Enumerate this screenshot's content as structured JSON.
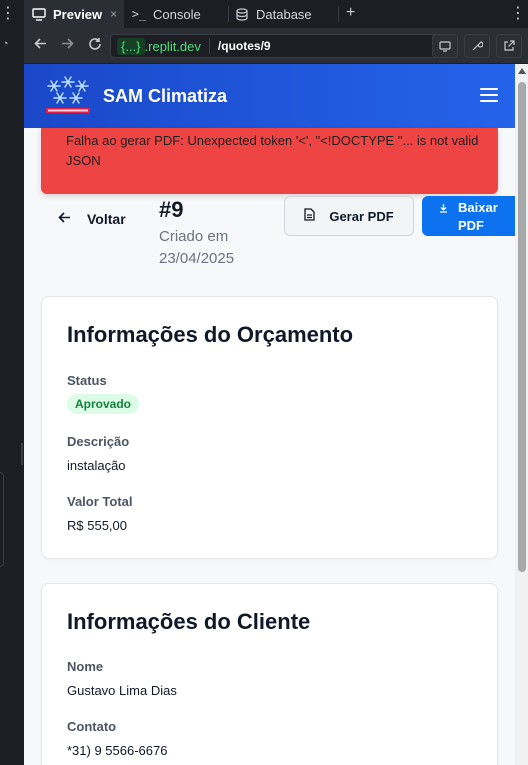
{
  "replit": {
    "tabs": [
      {
        "label": "Preview",
        "icon": "monitor-icon"
      },
      {
        "label": "Console",
        "icon": "terminal-icon"
      },
      {
        "label": "Database",
        "icon": "database-icon"
      }
    ],
    "tab_close": "×",
    "new_tab": "+",
    "url": {
      "host": "{...}",
      "domain": ".replit.dev",
      "path": "/quotes/9"
    }
  },
  "app": {
    "brand": "SAM Climatiza",
    "error": "Falha ao gerar PDF: Unexpected token '<', \"<!DOCTYPE \"... is not valid JSON",
    "back_label": "Voltar",
    "quote_number": "#9",
    "created_text": "Criado em 23/04/2025",
    "generate_pdf_label": "Gerar PDF",
    "download_pdf_label": "Baixar PDF",
    "quote_card": {
      "title": "Informações do Orçamento",
      "status_label": "Status",
      "status_value": "Aprovado",
      "description_label": "Descrição",
      "description_value": "instalação",
      "total_label": "Valor Total",
      "total_value": "R$ 555,00"
    },
    "client_card": {
      "title": "Informações do Cliente",
      "name_label": "Nome",
      "name_value": "Gustavo Lima Dias",
      "contact_label": "Contato",
      "contact_value": "*31) 9 5566-6676"
    }
  },
  "colors": {
    "header": "#2563eb",
    "alert": "#ef4444",
    "primary_button": "#0d72f0",
    "status_badge_bg": "#dcfce7",
    "status_badge_text": "#15803d"
  }
}
